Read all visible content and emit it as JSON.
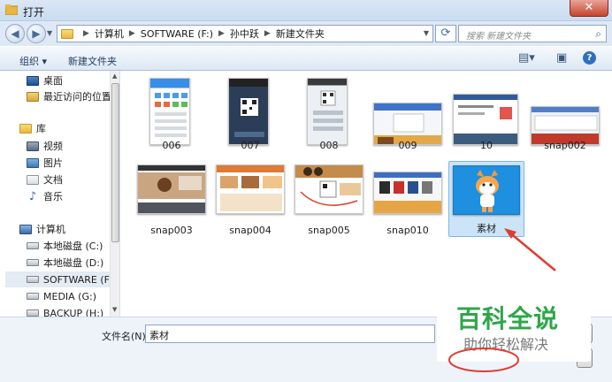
{
  "window": {
    "title": "打开",
    "close_glyph": "✕"
  },
  "navbar": {
    "back_glyph": "◀",
    "forward_glyph": "▶",
    "breadcrumbs": [
      "计算机",
      "SOFTWARE (F:)",
      "孙中跃",
      "新建文件夹"
    ],
    "refresh_glyph": "⟳",
    "search_placeholder": "搜索 新建文件夹",
    "search_icon": "search-icon"
  },
  "toolbar": {
    "organize_label": "组织 ▾",
    "new_folder_label": "新建文件夹",
    "help_glyph": "?"
  },
  "sidebar": {
    "items": [
      {
        "label": "桌面",
        "icon": "desktop-icon"
      },
      {
        "label": "最近访问的位置",
        "icon": "recent-places-icon"
      },
      {
        "label": "库",
        "icon": "library-icon"
      },
      {
        "label": "视频",
        "icon": "video-library-icon"
      },
      {
        "label": "图片",
        "icon": "pictures-library-icon"
      },
      {
        "label": "文档",
        "icon": "documents-library-icon"
      },
      {
        "label": "音乐",
        "icon": "music-library-icon"
      },
      {
        "label": "计算机",
        "icon": "computer-icon"
      },
      {
        "label": "本地磁盘 (C:)",
        "icon": "drive-icon"
      },
      {
        "label": "本地磁盘 (D:)",
        "icon": "drive-icon"
      },
      {
        "label": "SOFTWARE (F:)",
        "icon": "drive-icon",
        "selected": true
      },
      {
        "label": "MEDIA (G:)",
        "icon": "drive-icon"
      },
      {
        "label": "BACKUP (H:)",
        "icon": "drive-icon"
      }
    ]
  },
  "files": [
    {
      "name": "006"
    },
    {
      "name": "007"
    },
    {
      "name": "008"
    },
    {
      "name": "009"
    },
    {
      "name": "10"
    },
    {
      "name": "snap002"
    },
    {
      "name": "snap003"
    },
    {
      "name": "snap004"
    },
    {
      "name": "snap005"
    },
    {
      "name": "snap010"
    },
    {
      "name": "素材",
      "selected": true
    }
  ],
  "footer": {
    "filename_label": "文件名(N):",
    "filename_value": "素材"
  },
  "watermark": {
    "brand": "百科全说",
    "slogan": "助你轻松解决"
  },
  "colors": {
    "accent": "#2ea64a",
    "selection": "#cce4f7",
    "annotation_red": "#e03c32"
  }
}
